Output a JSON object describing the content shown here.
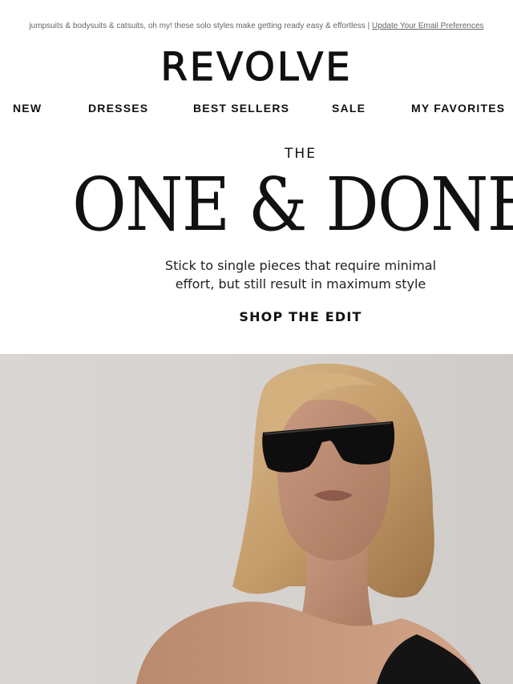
{
  "preheader": {
    "text": "jumpsuits & bodysuits & catsuits, oh my! these solo styles make getting ready easy & effortless | ",
    "link": "Update Your Email Preferences"
  },
  "brand": {
    "logo": "REVOLVE"
  },
  "nav": {
    "items": [
      "NEW",
      "DRESSES",
      "BEST SELLERS",
      "SALE",
      "MY FAVORITES"
    ]
  },
  "hero": {
    "eyebrow": "THE",
    "title": "ONE & DONE",
    "subtitle_line1": "Stick to single pieces that require minimal",
    "subtitle_line2": "effort, but still result in maximum style",
    "cta": "SHOP THE EDIT"
  },
  "photo": {
    "subject": "model-wearing-black-sunglasses"
  },
  "colors": {
    "text": "#111111",
    "muted": "#666666",
    "photo_background": "#d6d2cf"
  }
}
